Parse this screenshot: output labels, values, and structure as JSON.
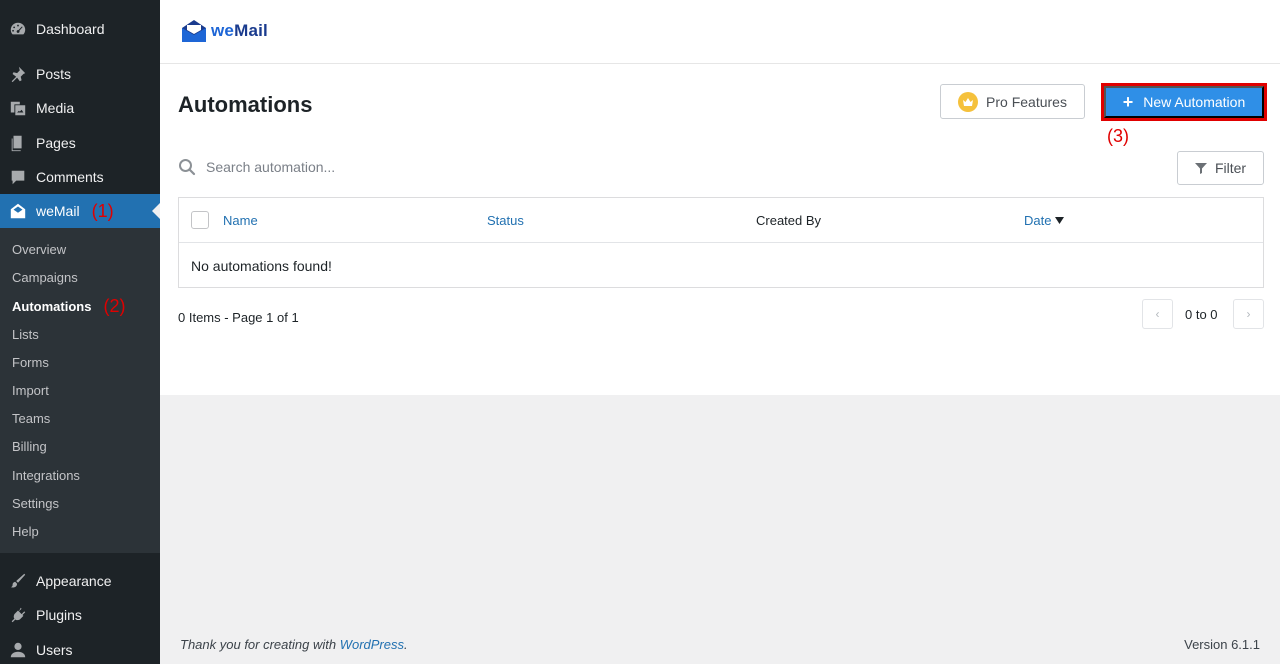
{
  "sidebar": {
    "top_items": [
      {
        "label": "Dashboard",
        "icon": "dashboard-icon"
      },
      {
        "label": "Posts",
        "icon": "pin-icon"
      },
      {
        "label": "Media",
        "icon": "media-icon"
      },
      {
        "label": "Pages",
        "icon": "pages-icon"
      },
      {
        "label": "Comments",
        "icon": "comment-icon"
      },
      {
        "label": "weMail",
        "icon": "envelope-icon",
        "annotation": "(1)"
      }
    ],
    "submenu": [
      {
        "label": "Overview"
      },
      {
        "label": "Campaigns"
      },
      {
        "label": "Automations",
        "annotation": "(2)"
      },
      {
        "label": "Lists"
      },
      {
        "label": "Forms"
      },
      {
        "label": "Import"
      },
      {
        "label": "Teams"
      },
      {
        "label": "Billing"
      },
      {
        "label": "Integrations"
      },
      {
        "label": "Settings"
      },
      {
        "label": "Help"
      }
    ],
    "bottom_items": [
      {
        "label": "Appearance",
        "icon": "brush-icon"
      },
      {
        "label": "Plugins",
        "icon": "plug-icon"
      },
      {
        "label": "Users",
        "icon": "user-icon"
      }
    ]
  },
  "header": {
    "logo_we": "we",
    "logo_mail": "Mail"
  },
  "main": {
    "title": "Automations",
    "pro_features_label": "Pro Features",
    "new_automation_label": "New Automation",
    "annotation_3": "(3)",
    "search_placeholder": "Search automation...",
    "filter_label": "Filter",
    "table": {
      "columns": [
        "Name",
        "Status",
        "Created By",
        "Date"
      ],
      "empty_message": "No automations found!"
    },
    "items_summary": "0 Items - Page 1 of 1",
    "pager_text": "0 to 0"
  },
  "footer": {
    "thanks_prefix": "Thank you for creating with ",
    "thanks_link": "WordPress",
    "thanks_suffix": ".",
    "version": "Version 6.1.1"
  },
  "colors": {
    "sidebar_bg": "#1d2327",
    "active_blue": "#2271b1",
    "button_blue": "#2f8fe7",
    "annotation_red": "#e00000"
  }
}
